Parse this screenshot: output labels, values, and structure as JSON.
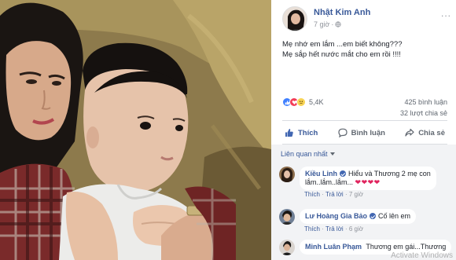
{
  "post": {
    "author": "Nhật Kim Anh",
    "time": "7 giờ",
    "more_label": "...",
    "text_lines": [
      "Mẹ nhớ em lắm ...em biết không???",
      "Mẹ sắp hết nước mắt cho em rồi !!!!"
    ]
  },
  "stats": {
    "reactions_count": "5,4K",
    "comments_count": "425 bình luận",
    "shares_count": "32 lượt chia sẻ",
    "reaction_icons": [
      "like-icon",
      "love-icon",
      "sad-icon"
    ]
  },
  "actions": {
    "like": "Thích",
    "comment": "Bình luận",
    "share": "Chia sẻ"
  },
  "comments_filter": "Liên quan nhất",
  "comments": [
    {
      "name": "Kiều Linh",
      "text": "Hiểu và Thương 2 mẹ con",
      "text2": "lắm..lắm..lắm...",
      "hearts": "❤❤❤❤",
      "like": "Thích",
      "reply": "Trả lời",
      "time": "7 giờ"
    },
    {
      "name": "Lư Hoàng Gia Bảo",
      "text": "Cố lên em",
      "like": "Thích",
      "reply": "Trả lời",
      "time": "6 giờ"
    },
    {
      "name": "Minh Luân Phạm",
      "text": "Thương em gái...Thương"
    }
  ],
  "watermark": "Activate Windows",
  "colors": {
    "link": "#385898",
    "text": "#1d2129",
    "muted": "#606770",
    "comment_bg": "#f2f3f5"
  }
}
